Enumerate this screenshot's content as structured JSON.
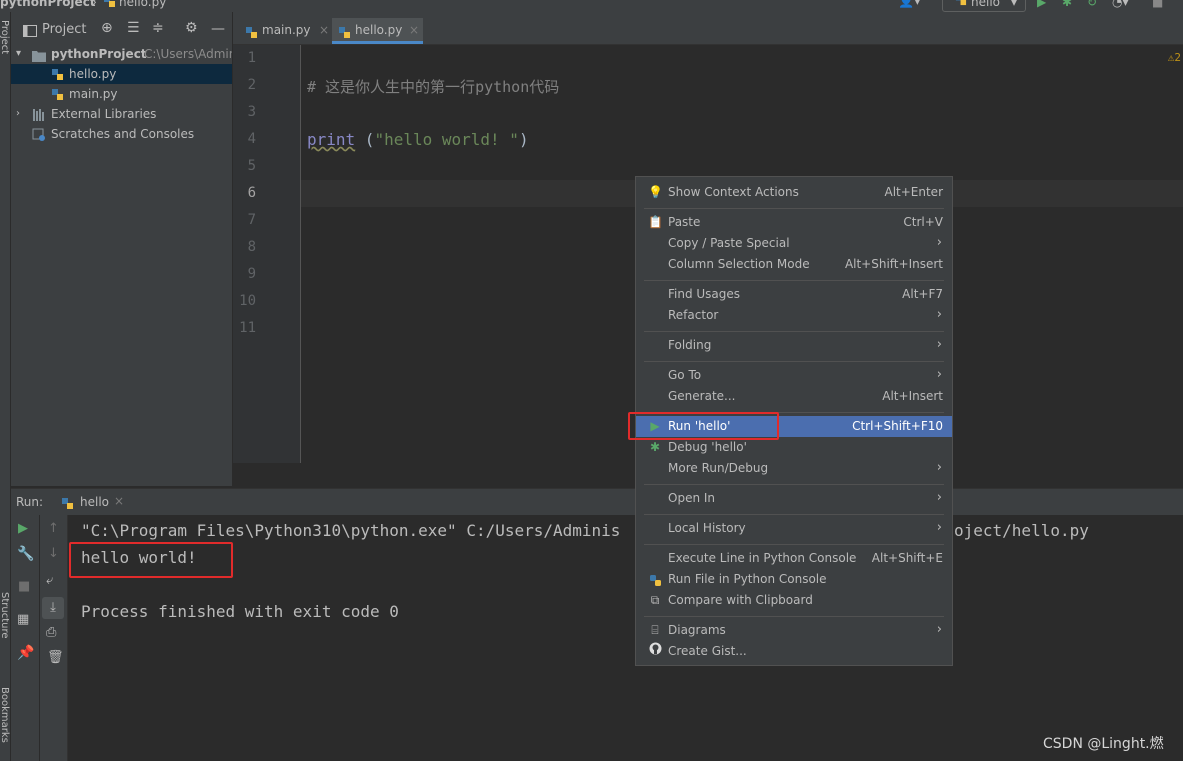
{
  "breadcrumb": {
    "project": "pythonProject",
    "file": "hello.py"
  },
  "run_config": {
    "name": "hello"
  },
  "left_strip": {
    "project_label": "Project",
    "structure_label": "Structure",
    "bookmarks_label": "Bookmarks"
  },
  "project_panel": {
    "title": "Project",
    "items": [
      {
        "label": "pythonProject",
        "path": "C:\\Users\\Admin"
      },
      {
        "label": "hello.py"
      },
      {
        "label": "main.py"
      },
      {
        "label": "External Libraries"
      },
      {
        "label": "Scratches and Consoles"
      }
    ]
  },
  "editor": {
    "tabs": [
      {
        "label": "main.py"
      },
      {
        "label": "hello.py"
      }
    ],
    "line_numbers": [
      "1",
      "2",
      "3",
      "4",
      "5",
      "6",
      "7",
      "8",
      "9",
      "10",
      "11"
    ],
    "code": {
      "comment": "# 这是你人生中的第一行python代码",
      "func": "print",
      "open": " (",
      "string": "\"hello world! \"",
      "close": ")"
    },
    "warning": "2"
  },
  "run_panel": {
    "label": "Run:",
    "tab": "hello",
    "lines": [
      "\"C:\\Program Files\\Python310\\python.exe\" C:/Users/Adminis",
      "hello world!",
      "Process finished with exit code 0"
    ],
    "line_tail": "oject/hello.py"
  },
  "context_menu": {
    "items": [
      {
        "label": "Show Context Actions",
        "shortcut": "Alt+Enter"
      },
      {
        "label": "Paste",
        "shortcut": "Ctrl+V"
      },
      {
        "label": "Copy / Paste Special"
      },
      {
        "label": "Column Selection Mode",
        "shortcut": "Alt+Shift+Insert"
      },
      {
        "label": "Find Usages",
        "shortcut": "Alt+F7"
      },
      {
        "label": "Refactor"
      },
      {
        "label": "Folding"
      },
      {
        "label": "Go To"
      },
      {
        "label": "Generate...",
        "shortcut": "Alt+Insert"
      },
      {
        "label": "Run 'hello'",
        "shortcut": "Ctrl+Shift+F10"
      },
      {
        "label": "Debug 'hello'"
      },
      {
        "label": "More Run/Debug"
      },
      {
        "label": "Open In"
      },
      {
        "label": "Local History"
      },
      {
        "label": "Execute Line in Python Console",
        "shortcut": "Alt+Shift+E"
      },
      {
        "label": "Run File in Python Console"
      },
      {
        "label": "Compare with Clipboard"
      },
      {
        "label": "Diagrams"
      },
      {
        "label": "Create Gist..."
      }
    ]
  },
  "watermark": "CSDN @Linght.燃",
  "colors": {
    "accent": "#4b6eaf",
    "highlight_box": "#e12b2b",
    "string": "#6a8759",
    "keyword": "#8888c6",
    "comment": "#808080"
  }
}
